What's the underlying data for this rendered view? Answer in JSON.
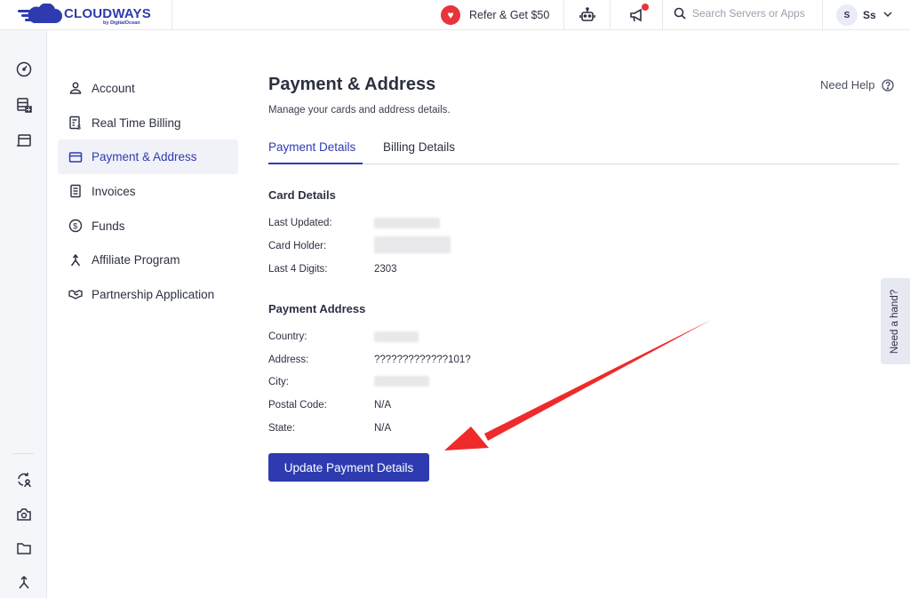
{
  "header": {
    "logo_text": "CLOUDWAYS",
    "logo_sub": "by DigitalOcean",
    "refer_label": "Refer & Get $50",
    "search_placeholder": "Search Servers or Apps",
    "avatar_initial": "S",
    "user_name": "Ss"
  },
  "sidebar": {
    "items": [
      {
        "label": "Account",
        "icon": "user-icon"
      },
      {
        "label": "Real Time Billing",
        "icon": "billing-icon"
      },
      {
        "label": "Payment & Address",
        "icon": "card-icon",
        "active": true
      },
      {
        "label": "Invoices",
        "icon": "invoice-icon"
      },
      {
        "label": "Funds",
        "icon": "dollar-icon"
      },
      {
        "label": "Affiliate Program",
        "icon": "merge-icon"
      },
      {
        "label": "Partnership Application",
        "icon": "handshake-icon"
      }
    ]
  },
  "main": {
    "title": "Payment & Address",
    "subtitle": "Manage your cards and address details.",
    "help_label": "Need Help",
    "tabs": [
      {
        "label": "Payment Details",
        "active": true
      },
      {
        "label": "Billing Details"
      }
    ],
    "card": {
      "title": "Card Details",
      "last_updated_label": "Last Updated:",
      "card_holder_label": "Card Holder:",
      "last4_label": "Last 4 Digits:",
      "last4_value": "2303"
    },
    "address": {
      "title": "Payment Address",
      "country_label": "Country:",
      "address_label": "Address:",
      "address_value": "?????????????101?",
      "city_label": "City:",
      "postal_label": "Postal Code:",
      "postal_value": "N/A",
      "state_label": "State:",
      "state_value": "N/A"
    },
    "update_button": "Update Payment Details"
  },
  "side_tab": "Need a hand?",
  "colors": {
    "brand": "#2e3bb0",
    "alert": "#e8343a",
    "annotation_arrow": "#ee2a2a"
  }
}
